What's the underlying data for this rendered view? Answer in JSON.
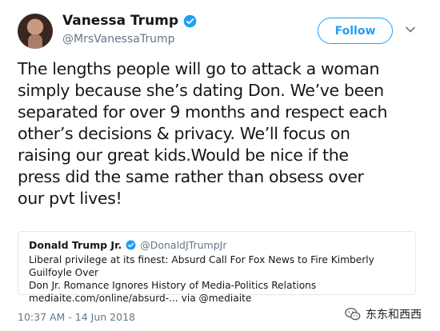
{
  "author": {
    "name": "Vanessa Trump",
    "handle": "@MrsVanessaTrump",
    "verified_icon": "verified-badge-icon"
  },
  "follow_button": {
    "label": "Follow"
  },
  "menu_icon": "chevron-down-icon",
  "tweet": {
    "text": "The lengths people will go to attack a woman\nsimply because she’s dating Don. We’ve been\nseparated for over 9 months and respect each\nother’s decisions & privacy. We’ll focus on\nraising our great kids.Would be nice if the\npress did the same rather than obsess over\nour pvt lives!"
  },
  "quoted_tweet": {
    "name": "Donald Trump Jr.",
    "handle": "@DonaldJTrumpJr",
    "text": "Liberal privilege at its finest: Absurd Call For Fox News to Fire Kimberly Guilfoyle Over\nDon Jr. Romance Ignores History of Media-Politics Relations\nmediaite.com/online/absurd-... via @mediaite"
  },
  "timestamp": "10:37 AM - 14 Jun 2018",
  "watermark": {
    "text": "东东和西西",
    "icon": "wechat-icon"
  },
  "colors": {
    "accent": "#1da1f2",
    "text": "#14171a",
    "secondary_text": "#657786",
    "border": "#e1e8ed"
  }
}
